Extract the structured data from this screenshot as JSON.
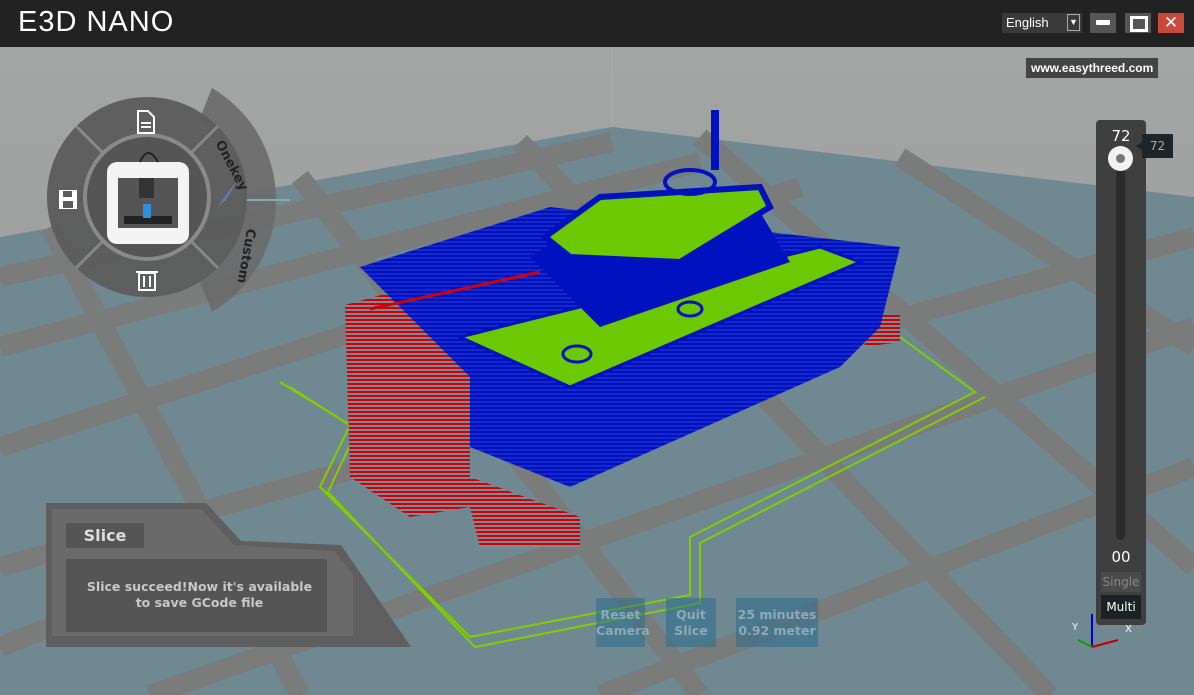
{
  "window": {
    "title": "E3D NANO",
    "language": "English",
    "close_glyph": "✕"
  },
  "watermark": "www.easythreed.com",
  "radial_menu": {
    "items": [
      {
        "name": "open-file",
        "icon": "document-icon"
      },
      {
        "name": "save",
        "icon": "floppy-disk-icon"
      },
      {
        "name": "delete",
        "icon": "trash-icon"
      },
      {
        "name": "slice",
        "icon": "knife-icon"
      }
    ],
    "onekey_label": "Onekey",
    "custom_label": "Custom"
  },
  "slice_panel": {
    "title": "Slice",
    "message": "Slice succeed!Now it's available to save GCode file"
  },
  "bottom": {
    "reset_camera": "Reset Camera",
    "quit_slice": "Quit Slice",
    "time": "25 minutes",
    "length": "0.92 meter"
  },
  "layer_slider": {
    "top_label": "72",
    "tooltip": "72",
    "bottom_label": "00",
    "current": 72,
    "max": 72,
    "single_label": "Single",
    "multi_label": "Multi"
  },
  "axes": {
    "x": "X",
    "y": "Y"
  },
  "colors": {
    "support": "#d0000a",
    "wall": "#0012c0",
    "infill": "#6cc800",
    "floor": "#6f8891",
    "titlebar": "#222222"
  }
}
